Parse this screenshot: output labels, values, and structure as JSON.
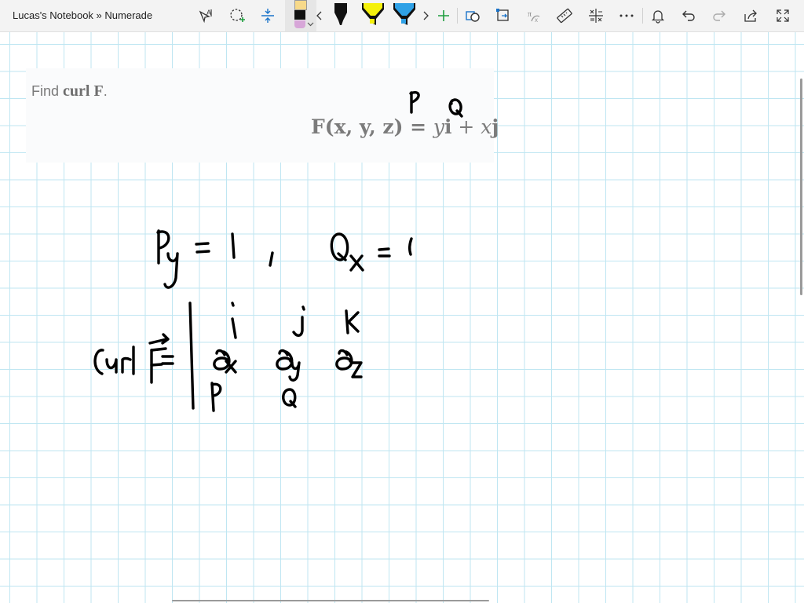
{
  "window": {
    "title": "Lucas's Notebook » Numerade"
  },
  "toolbar": {
    "tools": [
      {
        "name": "text-select-tool"
      },
      {
        "name": "lasso-tool"
      },
      {
        "name": "add-space-tool"
      },
      {
        "name": "pen-color-tool"
      },
      {
        "name": "black-pen"
      },
      {
        "name": "yellow-highlighter"
      },
      {
        "name": "blue-highlighter"
      },
      {
        "name": "add-pen"
      },
      {
        "name": "shapes-tool"
      },
      {
        "name": "ink-to-shape"
      },
      {
        "name": "ink-to-math"
      },
      {
        "name": "ruler"
      },
      {
        "name": "math-tool"
      },
      {
        "name": "more-options"
      },
      {
        "name": "notifications"
      },
      {
        "name": "undo"
      },
      {
        "name": "redo"
      },
      {
        "name": "share"
      },
      {
        "name": "fullscreen"
      }
    ],
    "colors": {
      "pen_top": "#f7d98a",
      "pen_bottom": "#b07fb0",
      "yellow": "#f5f10c",
      "blue": "#2fa1e6",
      "add": "#1e9e3e"
    }
  },
  "problem": {
    "find_prefix": "Find",
    "find_bold": "curl F",
    "find_suffix": ".",
    "formula_lhs": "F(x, y, z) = ",
    "formula_y": "y",
    "formula_i": "i",
    "formula_plus": " + ",
    "formula_x": "x",
    "formula_j": "j"
  },
  "handwriting": {
    "label_p": "P",
    "label_q": "Q",
    "line1": "Py = 1 ,  Qx = 1",
    "line2": "Curl F = | i j k ; ∂x ∂y ∂z ; P Q"
  },
  "grid_color": "#bfe6f2"
}
